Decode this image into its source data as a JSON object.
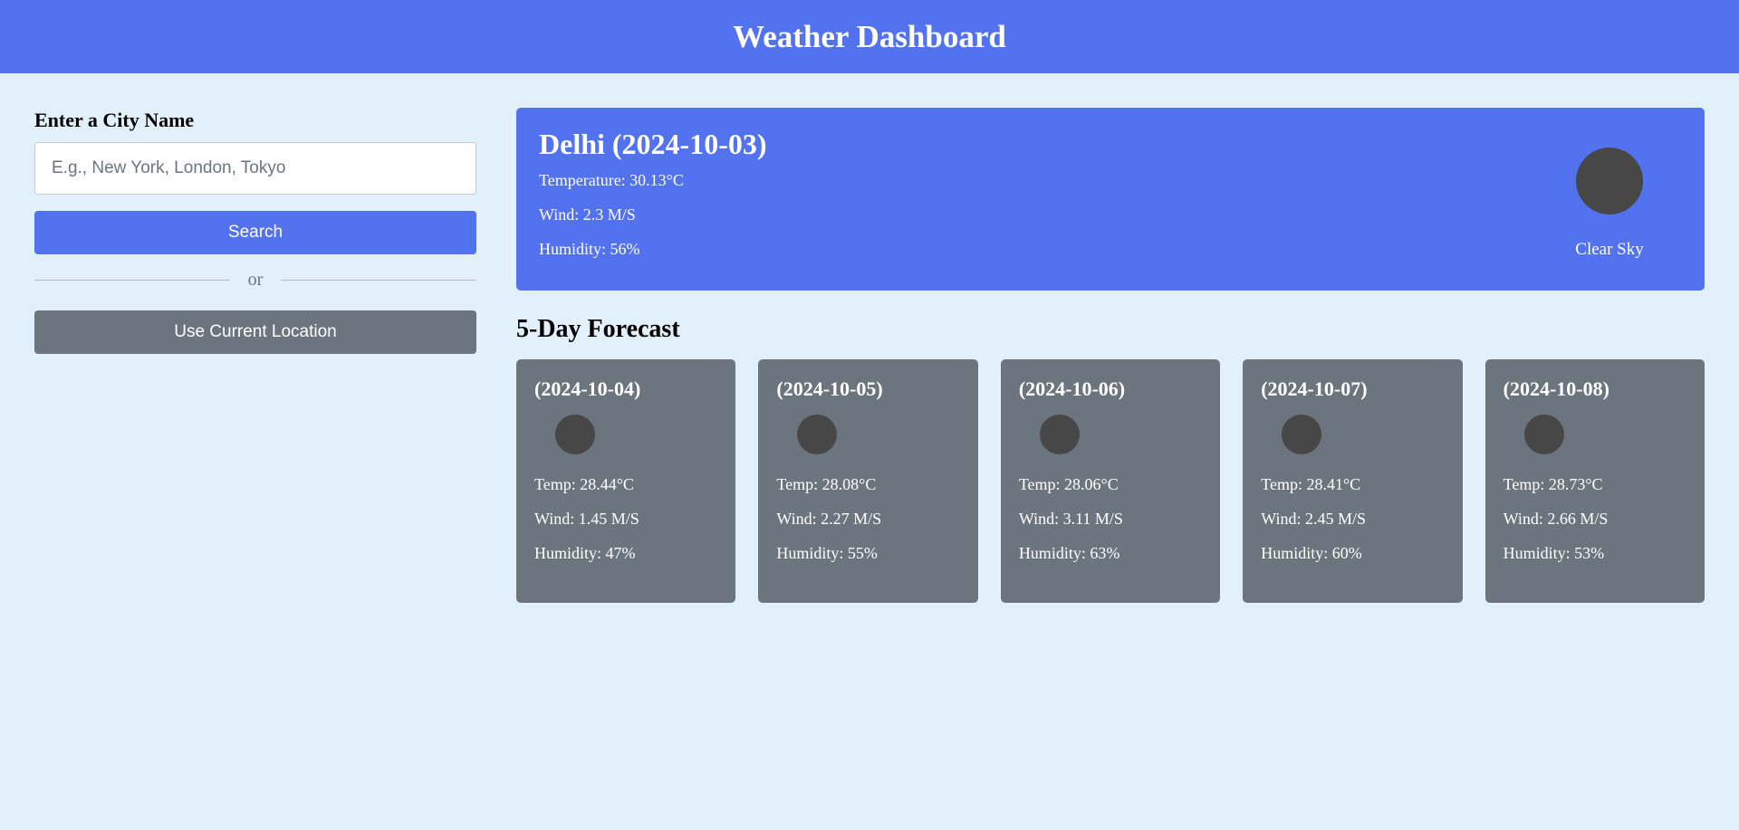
{
  "header": {
    "title": "Weather Dashboard"
  },
  "sidebar": {
    "heading": "Enter a City Name",
    "input_placeholder": "E.g., New York, London, Tokyo",
    "input_value": "",
    "search_label": "Search",
    "separator_text": "or",
    "location_label": "Use Current Location"
  },
  "current": {
    "title": "Delhi (2024-10-03)",
    "temperature": "Temperature: 30.13°C",
    "wind": "Wind: 2.3 M/S",
    "humidity": "Humidity: 56%",
    "description": "Clear Sky",
    "icon": "weather-icon"
  },
  "forecast": {
    "title": "5-Day Forecast",
    "days": [
      {
        "date": "(2024-10-04)",
        "temp": "Temp: 28.44°C",
        "wind": "Wind: 1.45 M/S",
        "humidity": "Humidity: 47%"
      },
      {
        "date": "(2024-10-05)",
        "temp": "Temp: 28.08°C",
        "wind": "Wind: 2.27 M/S",
        "humidity": "Humidity: 55%"
      },
      {
        "date": "(2024-10-06)",
        "temp": "Temp: 28.06°C",
        "wind": "Wind: 3.11 M/S",
        "humidity": "Humidity: 63%"
      },
      {
        "date": "(2024-10-07)",
        "temp": "Temp: 28.41°C",
        "wind": "Wind: 2.45 M/S",
        "humidity": "Humidity: 60%"
      },
      {
        "date": "(2024-10-08)",
        "temp": "Temp: 28.73°C",
        "wind": "Wind: 2.66 M/S",
        "humidity": "Humidity: 53%"
      }
    ]
  },
  "colors": {
    "primary": "#5372f0",
    "secondary": "#6c757d",
    "background": "#e2f0fb",
    "icon_placeholder": "#474747"
  }
}
